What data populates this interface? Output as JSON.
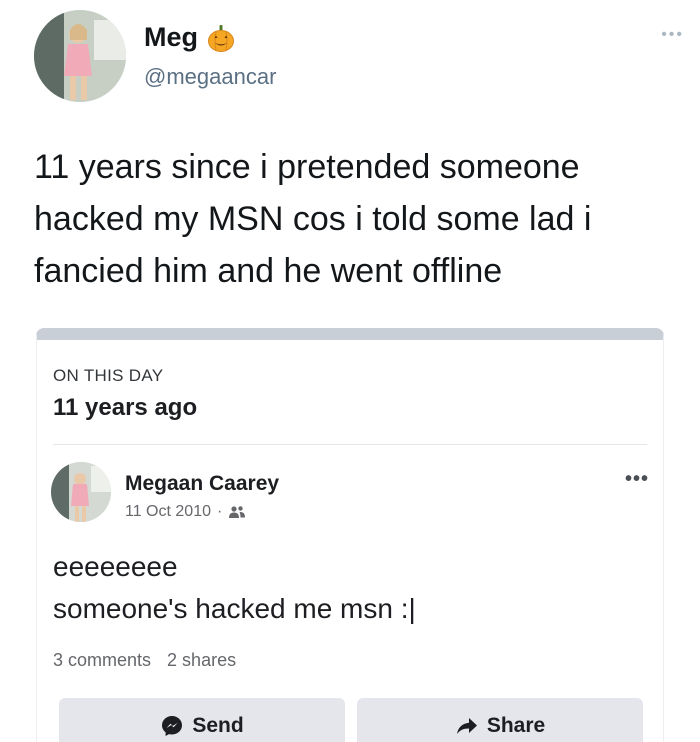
{
  "tweet": {
    "name": "Meg",
    "handle": "@megaancar",
    "text": "11 years since i pretended someone hacked my MSN cos i told some lad i fancied him and he went offline"
  },
  "memory": {
    "label": "ON THIS DAY",
    "ago": "11 years ago"
  },
  "post": {
    "author": "Megaan Caarey",
    "date": "11 Oct 2010",
    "separator": "·",
    "line1": "eeeeeeee",
    "line2": "someone's hacked me msn :|",
    "comments": "3 comments",
    "shares": "2 shares"
  },
  "actions": {
    "send_label": "Send",
    "share_label": "Share"
  },
  "icons": [
    "pumpkin-icon",
    "more-icon",
    "friends-icon",
    "messenger-icon",
    "share-arrow-icon"
  ],
  "colors": {
    "handle": "#5b7083",
    "button_bg": "#e4e6eb",
    "card_top_bar": "#c9cfd6",
    "pumpkin": "#f5a623"
  }
}
